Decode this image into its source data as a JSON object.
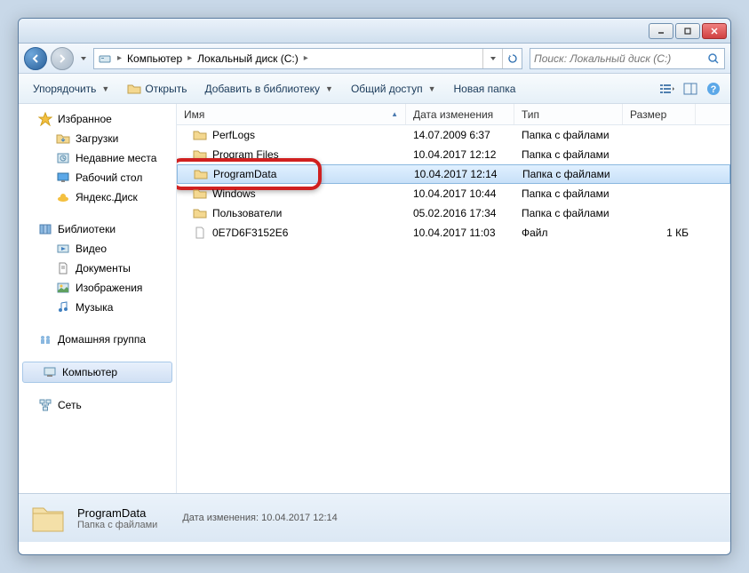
{
  "breadcrumb": {
    "root": "Компьютер",
    "drive": "Локальный диск (C:)"
  },
  "search": {
    "placeholder": "Поиск: Локальный диск (C:)"
  },
  "toolbar": {
    "organize": "Упорядочить",
    "open": "Открыть",
    "library": "Добавить в библиотеку",
    "share": "Общий доступ",
    "newfolder": "Новая папка"
  },
  "sidebar": {
    "favorites": {
      "label": "Избранное",
      "items": [
        "Загрузки",
        "Недавние места",
        "Рабочий стол",
        "Яндекс.Диск"
      ]
    },
    "libraries": {
      "label": "Библиотеки",
      "items": [
        "Видео",
        "Документы",
        "Изображения",
        "Музыка"
      ]
    },
    "homegroup": "Домашняя группа",
    "computer": "Компьютер",
    "network": "Сеть"
  },
  "columns": {
    "name": "Имя",
    "date": "Дата изменения",
    "type": "Тип",
    "size": "Размер"
  },
  "files": [
    {
      "name": "PerfLogs",
      "date": "14.07.2009 6:37",
      "type": "Папка с файлами",
      "size": "",
      "kind": "folder"
    },
    {
      "name": "Program Files",
      "date": "10.04.2017 12:12",
      "type": "Папка с файлами",
      "size": "",
      "kind": "folder"
    },
    {
      "name": "ProgramData",
      "date": "10.04.2017 12:14",
      "type": "Папка с файлами",
      "size": "",
      "kind": "folder",
      "selected": true,
      "highlight": true
    },
    {
      "name": "Windows",
      "date": "10.04.2017 10:44",
      "type": "Папка с файлами",
      "size": "",
      "kind": "folder"
    },
    {
      "name": "Пользователи",
      "date": "05.02.2016 17:34",
      "type": "Папка с файлами",
      "size": "",
      "kind": "folder"
    },
    {
      "name": "0E7D6F3152E6",
      "date": "10.04.2017 11:03",
      "type": "Файл",
      "size": "1 КБ",
      "kind": "file"
    }
  ],
  "details": {
    "name": "ProgramData",
    "type": "Папка с файлами",
    "datelabel": "Дата изменения:",
    "date": "10.04.2017 12:14"
  }
}
